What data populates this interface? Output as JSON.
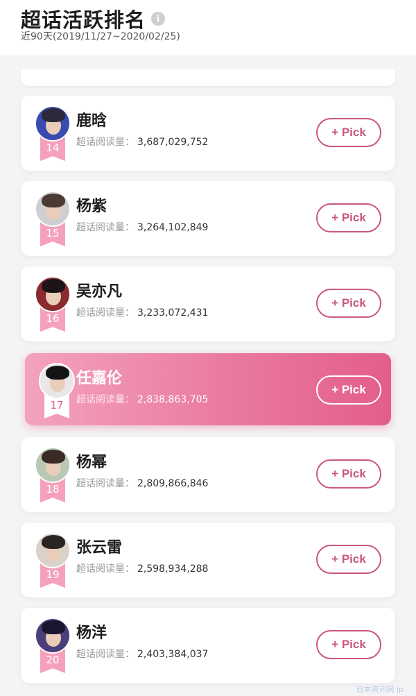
{
  "header": {
    "title": "超话活跃排名",
    "info_icon": "i",
    "subtitle": "近90天(2019/11/27~2020/02/25)"
  },
  "reads_label": "超话阅读量：",
  "pick_label": "+ Pick",
  "colors": {
    "accent": "#c9577f",
    "ribbon": "#f5a1bc",
    "highlight_start": "#f3a3bd",
    "highlight_end": "#e35e8a"
  },
  "rankings": [
    {
      "rank": "14",
      "name": "鹿晗",
      "reads": "3,687,029,752",
      "hair": "#2a2a3a",
      "bg": "#3a4bb0"
    },
    {
      "rank": "15",
      "name": "杨紫",
      "reads": "3,264,102,849",
      "hair": "#4a3a33",
      "bg": "#cfcfd3"
    },
    {
      "rank": "16",
      "name": "吴亦凡",
      "reads": "3,233,072,431",
      "hair": "#1c1416",
      "bg": "#8a2a2e"
    },
    {
      "rank": "17",
      "name": "任嘉伦",
      "reads": "2,838,863,705",
      "hair": "#141414",
      "bg": "#e8e6e6"
    },
    {
      "rank": "18",
      "name": "杨幂",
      "reads": "2,809,866,846",
      "hair": "#3b2a26",
      "bg": "#b9c7b3"
    },
    {
      "rank": "19",
      "name": "张云雷",
      "reads": "2,598,934,288",
      "hair": "#2a2422",
      "bg": "#d9d2cc"
    },
    {
      "rank": "20",
      "name": "杨洋",
      "reads": "2,403,384,037",
      "hair": "#1a1530",
      "bg": "#4a3f7a"
    }
  ],
  "watermark": "日本资讯网 jp"
}
